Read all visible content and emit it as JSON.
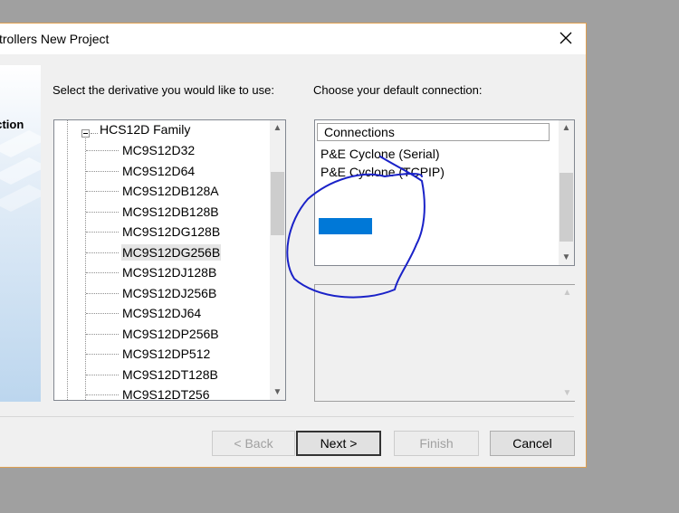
{
  "window": {
    "title": "trollers New Project"
  },
  "banner": {
    "label": "ection"
  },
  "labels": {
    "derivative_prompt": "Select the derivative you would like to use:",
    "connection_prompt": "Choose your default connection:"
  },
  "tree": {
    "family": "HCS12D Family",
    "items": [
      "MC9S12D32",
      "MC9S12D64",
      "MC9S12DB128A",
      "MC9S12DB128B",
      "MC9S12DG128B",
      "MC9S12DG256B",
      "MC9S12DJ128B",
      "MC9S12DJ256B",
      "MC9S12DJ64",
      "MC9S12DP256B",
      "MC9S12DP512",
      "MC9S12DT128B",
      "MC9S12DT256"
    ],
    "selected": "MC9S12DG256B"
  },
  "connections": {
    "header": "Connections",
    "items": [
      "P&E Cyclone (Serial)",
      "P&E Cyclone (TCPIP)"
    ]
  },
  "buttons": {
    "back": "< Back",
    "next": "Next >",
    "finish": "Finish",
    "cancel": "Cancel"
  },
  "colors": {
    "accent": "#0078d7",
    "annotation": "#1a22c8",
    "window_border": "#e0a050"
  }
}
